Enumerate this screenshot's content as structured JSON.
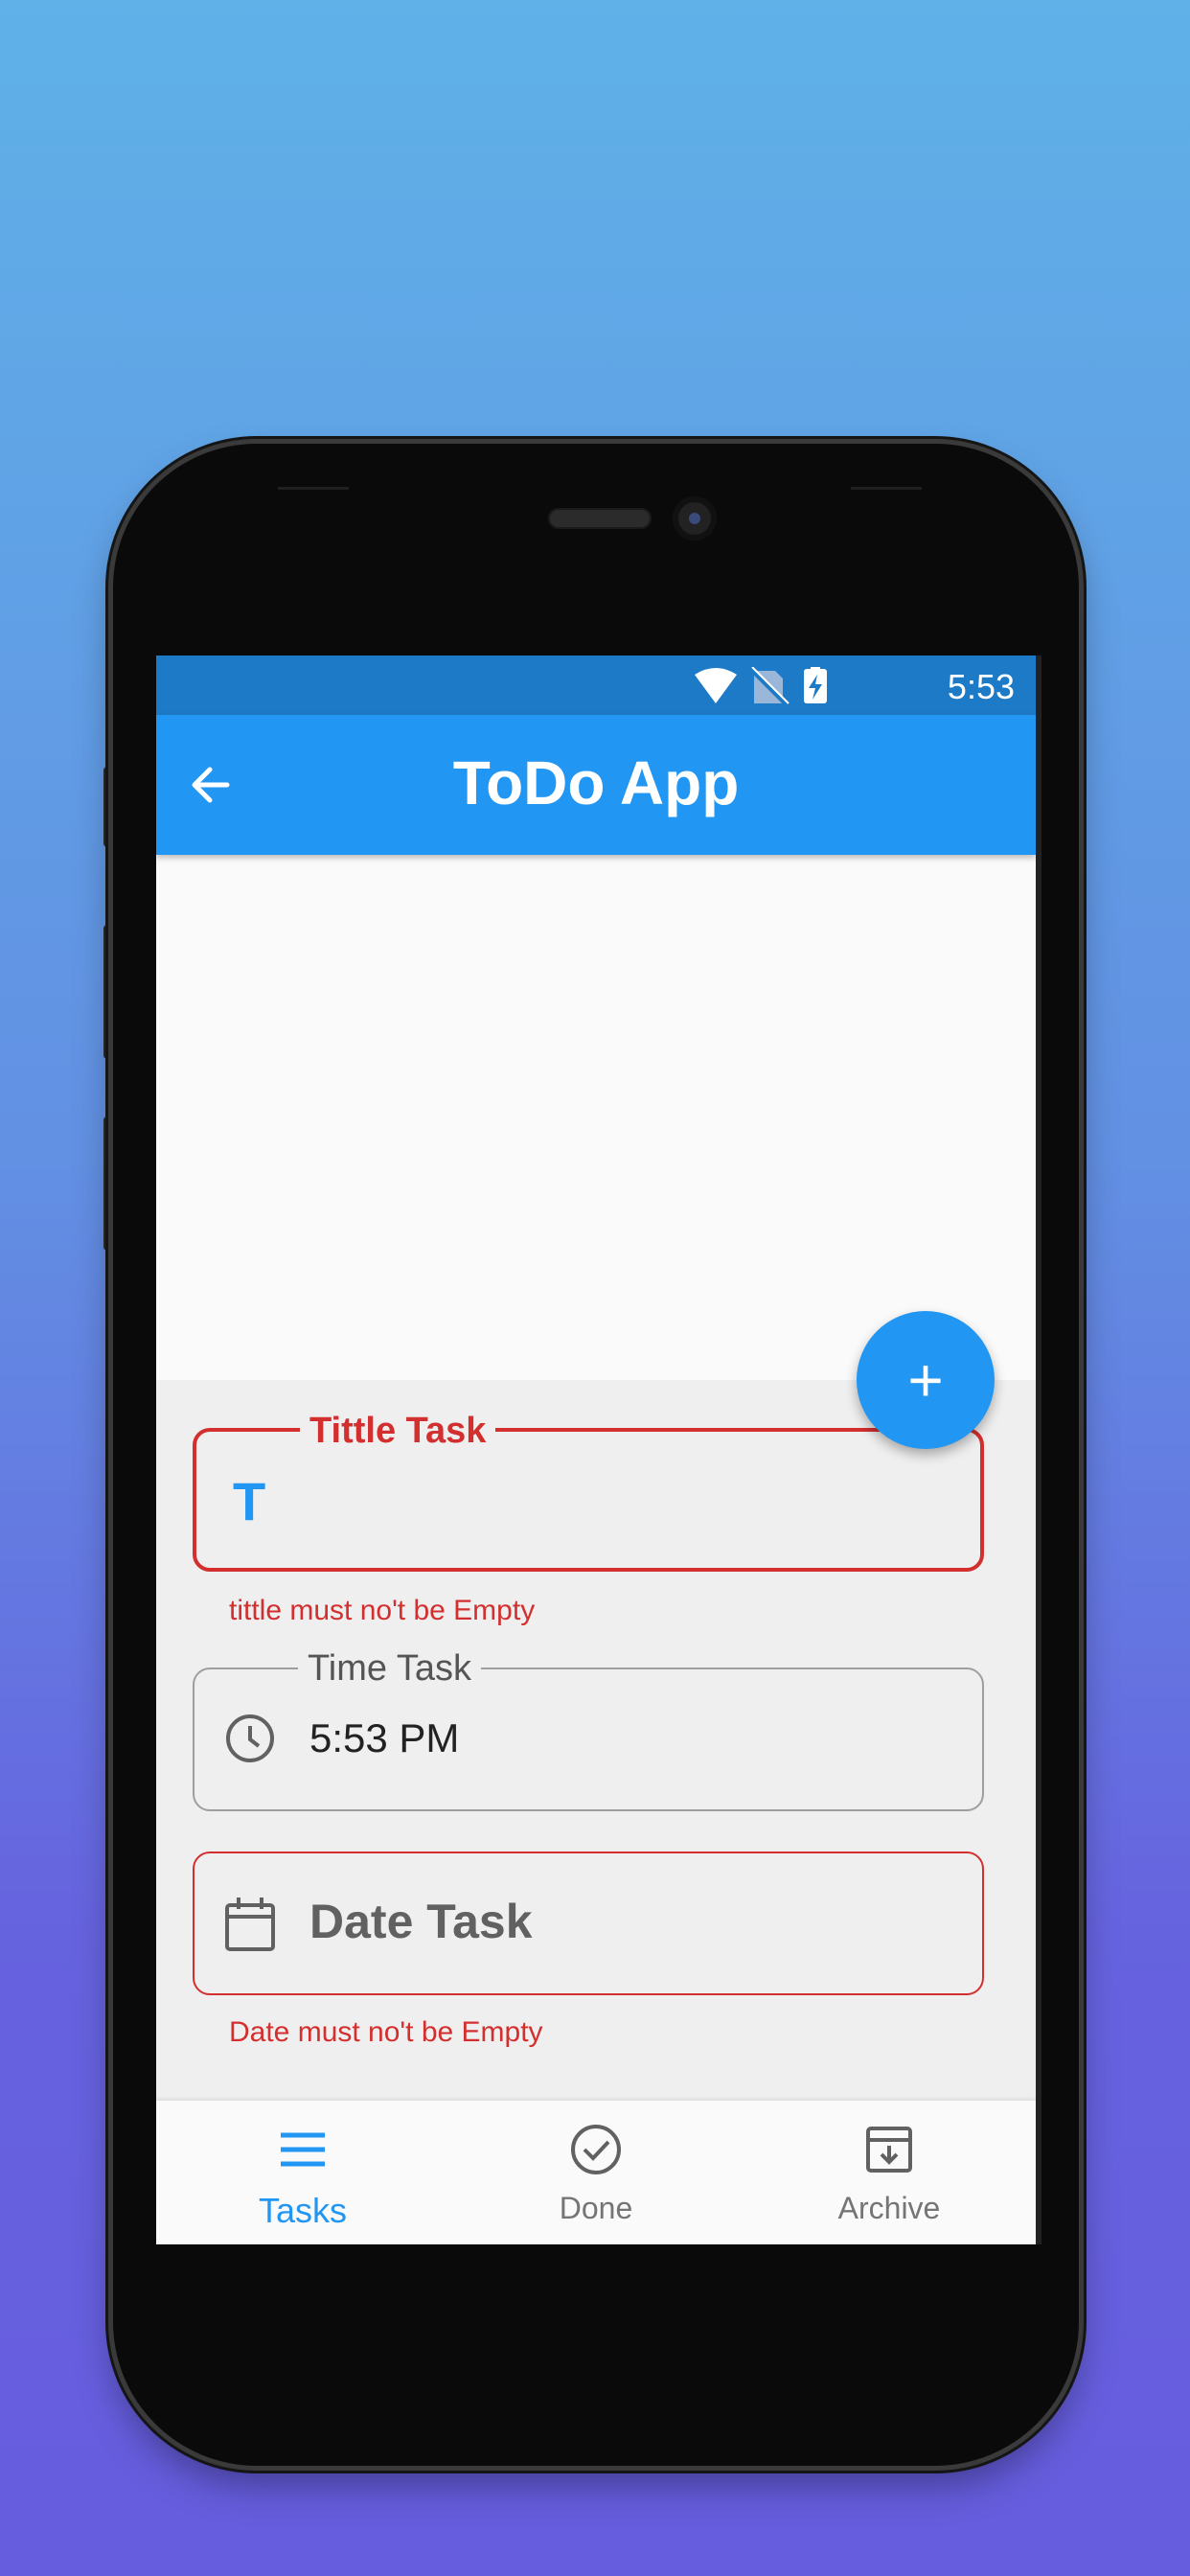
{
  "status_bar": {
    "time": "5:53"
  },
  "app_bar": {
    "title": "ToDo App",
    "back_icon": "arrow-left-icon"
  },
  "form": {
    "title_field": {
      "label": "Tittle Task",
      "icon": "T",
      "value": "",
      "error": "tittle must no't be Empty"
    },
    "time_field": {
      "label": "Time Task",
      "icon": "clock-icon",
      "value": "5:53 PM"
    },
    "date_field": {
      "placeholder": "Date Task",
      "icon": "calendar-icon",
      "error": "Date must no't be Empty"
    }
  },
  "fab": {
    "label": "+",
    "icon": "plus-icon"
  },
  "bottom_nav": {
    "items": [
      {
        "label": "Tasks",
        "icon": "menu-icon",
        "active": true
      },
      {
        "label": "Done",
        "icon": "check-circle-icon",
        "active": false
      },
      {
        "label": "Archive",
        "icon": "archive-icon",
        "active": false
      }
    ]
  },
  "colors": {
    "primary": "#2196f3",
    "status_bar": "#1d7ac7",
    "error": "#d32f2f"
  }
}
